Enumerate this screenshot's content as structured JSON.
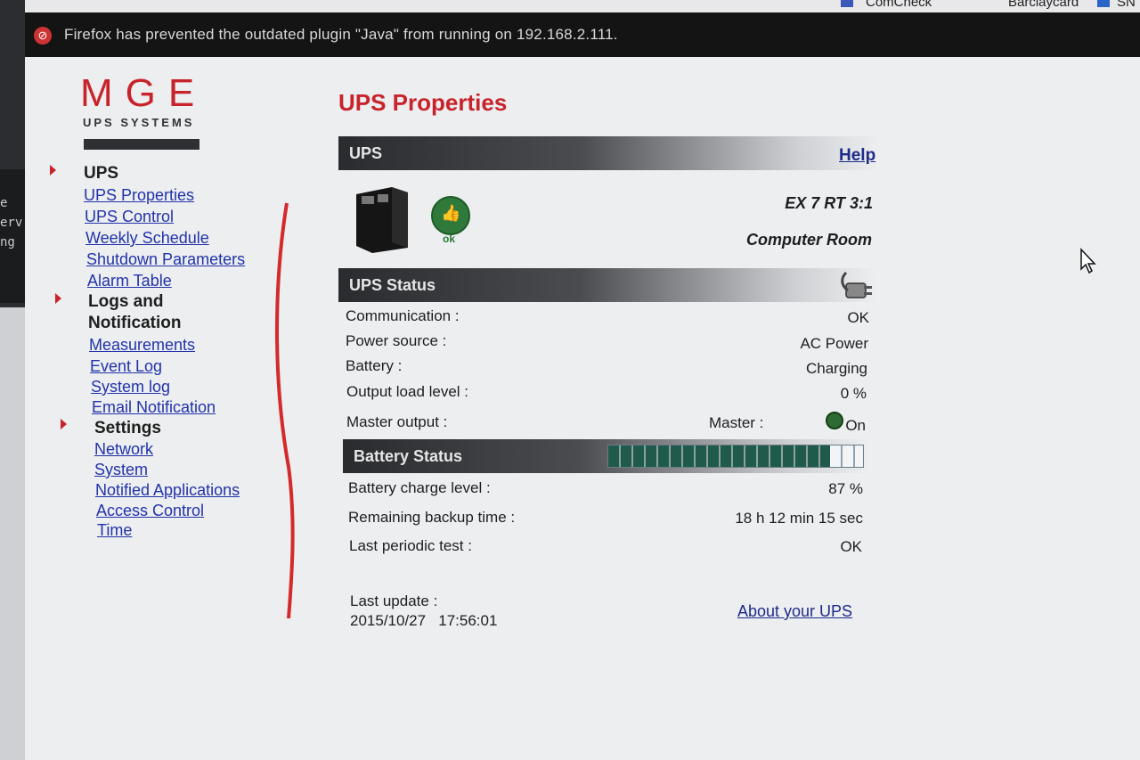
{
  "browser": {
    "bookmarks": [
      "ComCheck",
      "Barclaycard",
      "SN"
    ],
    "notification": "Firefox has prevented the outdated plugin \"Java\" from running on 192.168.2.111."
  },
  "background_terminal": {
    "lines": [
      "e",
      "erv",
      "ng"
    ]
  },
  "logo": {
    "brand": "MGE",
    "subtitle": "UPS SYSTEMS"
  },
  "sidebar": {
    "sections": [
      {
        "heading": "UPS",
        "links": [
          "UPS Properties",
          "UPS Control",
          "Weekly Schedule",
          "Shutdown Parameters",
          "Alarm Table"
        ]
      },
      {
        "heading_line1": "Logs and",
        "heading_line2": "Notification",
        "links": [
          "Measurements",
          "Event Log ",
          "System log",
          "Email Notification"
        ]
      },
      {
        "heading": "Settings",
        "links": [
          "Network",
          "System",
          "Notified Applications",
          "Access Control",
          "Time"
        ]
      }
    ]
  },
  "main": {
    "title": "UPS Properties",
    "ups_section": {
      "label": "UPS",
      "help": "Help",
      "status_badge": "ok",
      "model": "EX 7 RT 3:1",
      "location": "Computer Room"
    },
    "ups_status": {
      "label": "UPS Status",
      "rows": [
        {
          "label": "Communication :",
          "value": "OK"
        },
        {
          "label": "Power source :",
          "value": "AC Power"
        },
        {
          "label": "Battery :",
          "value": "Charging"
        },
        {
          "label": "Output load level :",
          "value": "0 %"
        }
      ],
      "master_output": {
        "label": "Master output :",
        "sublabel": "Master :",
        "value": "On"
      }
    },
    "battery_status": {
      "label": "Battery Status",
      "charge_fraction": 0.87,
      "rows": [
        {
          "label": "Battery charge level :",
          "value": "87 %"
        },
        {
          "label": "Remaining backup time :",
          "value": "18 h 12 min 15 sec"
        },
        {
          "label": "Last periodic test :",
          "value": "OK"
        }
      ]
    },
    "last_update": {
      "label": "Last update :",
      "value": "2015/10/27   17:56:01"
    },
    "about_link": "About your UPS"
  },
  "colors": {
    "brand_red": "#c8232b",
    "link_blue": "#2233aa",
    "battery_green": "#1f5a4c"
  }
}
